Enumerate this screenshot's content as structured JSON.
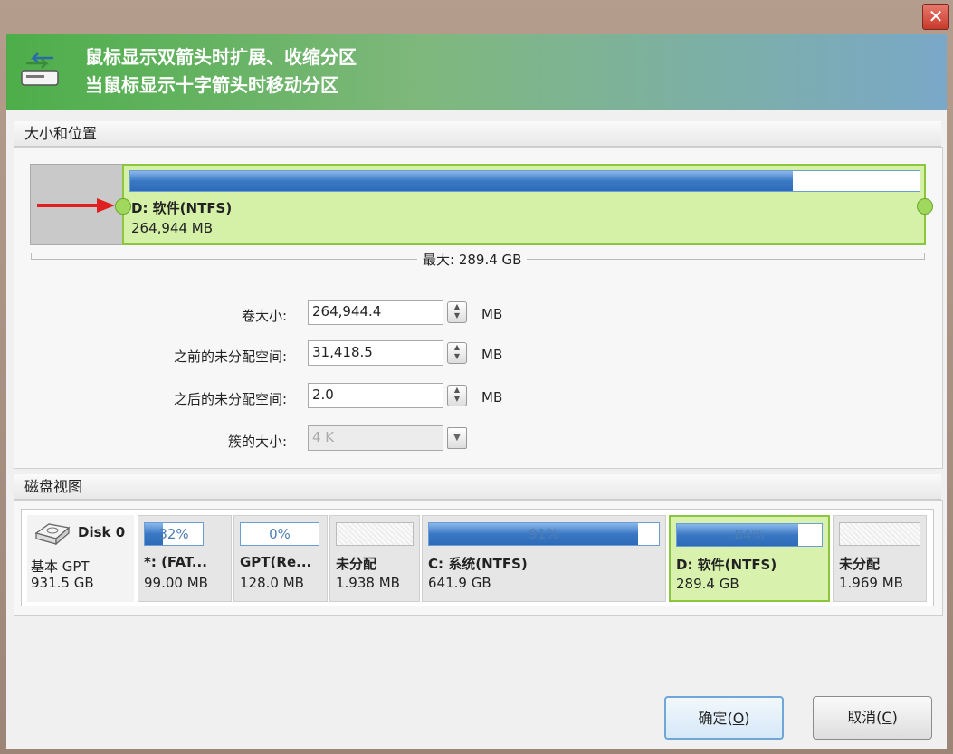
{
  "window": {
    "close_glyph": "✕"
  },
  "banner": {
    "line1": "鼠标显示双箭头时扩展、收缩分区",
    "line2": "当鼠标显示十字箭头时移动分区",
    "icon": "disk-resize-icon"
  },
  "size_position": {
    "section_title": "大小和位置",
    "partition_name": "D: 软件(NTFS)",
    "partition_size": "264,944 MB",
    "max_label": "最大: 289.4 GB",
    "usage_fraction": 0.84
  },
  "form": {
    "volume_size": {
      "label": "卷大小:",
      "value": "264,944.4",
      "unit": "MB"
    },
    "unallocated_before": {
      "label": "之前的未分配空间:",
      "value": "31,418.5",
      "unit": "MB"
    },
    "unallocated_after": {
      "label": "之后的未分配空间:",
      "value": "2.0",
      "unit": "MB"
    },
    "cluster_size": {
      "label": "簇的大小:",
      "value": "4 K"
    }
  },
  "disk_view": {
    "section_title": "磁盘视图",
    "disk": {
      "name": "Disk 0",
      "type": "基本 GPT",
      "size": "931.5 GB"
    },
    "partitions": [
      {
        "pct": "32%",
        "fill": 0.32,
        "name": "*: (FAT...",
        "size": "99.00 MB"
      },
      {
        "pct": "0%",
        "fill": 0.0,
        "name": "GPT(Re...",
        "size": "128.0 MB"
      },
      {
        "pct": "",
        "fill": 0,
        "name": "未分配",
        "size": "1.938 MB"
      },
      {
        "pct": "91%",
        "fill": 0.91,
        "name": "C: 系统(NTFS)",
        "size": "641.9 GB"
      },
      {
        "pct": "84%",
        "fill": 0.84,
        "name": "D: 软件(NTFS)",
        "size": "289.4 GB"
      },
      {
        "pct": "",
        "fill": 0,
        "name": "未分配",
        "size": "1.969 MB"
      }
    ]
  },
  "buttons": {
    "ok": {
      "text": "确定(",
      "key": "O",
      "close": ")"
    },
    "cancel": {
      "text": "取消(",
      "key": "C",
      "close": ")"
    }
  },
  "colors": {
    "accent_green": "#8cc63f",
    "bar_blue": "#3a78c4",
    "arrow_red": "#e02020"
  }
}
